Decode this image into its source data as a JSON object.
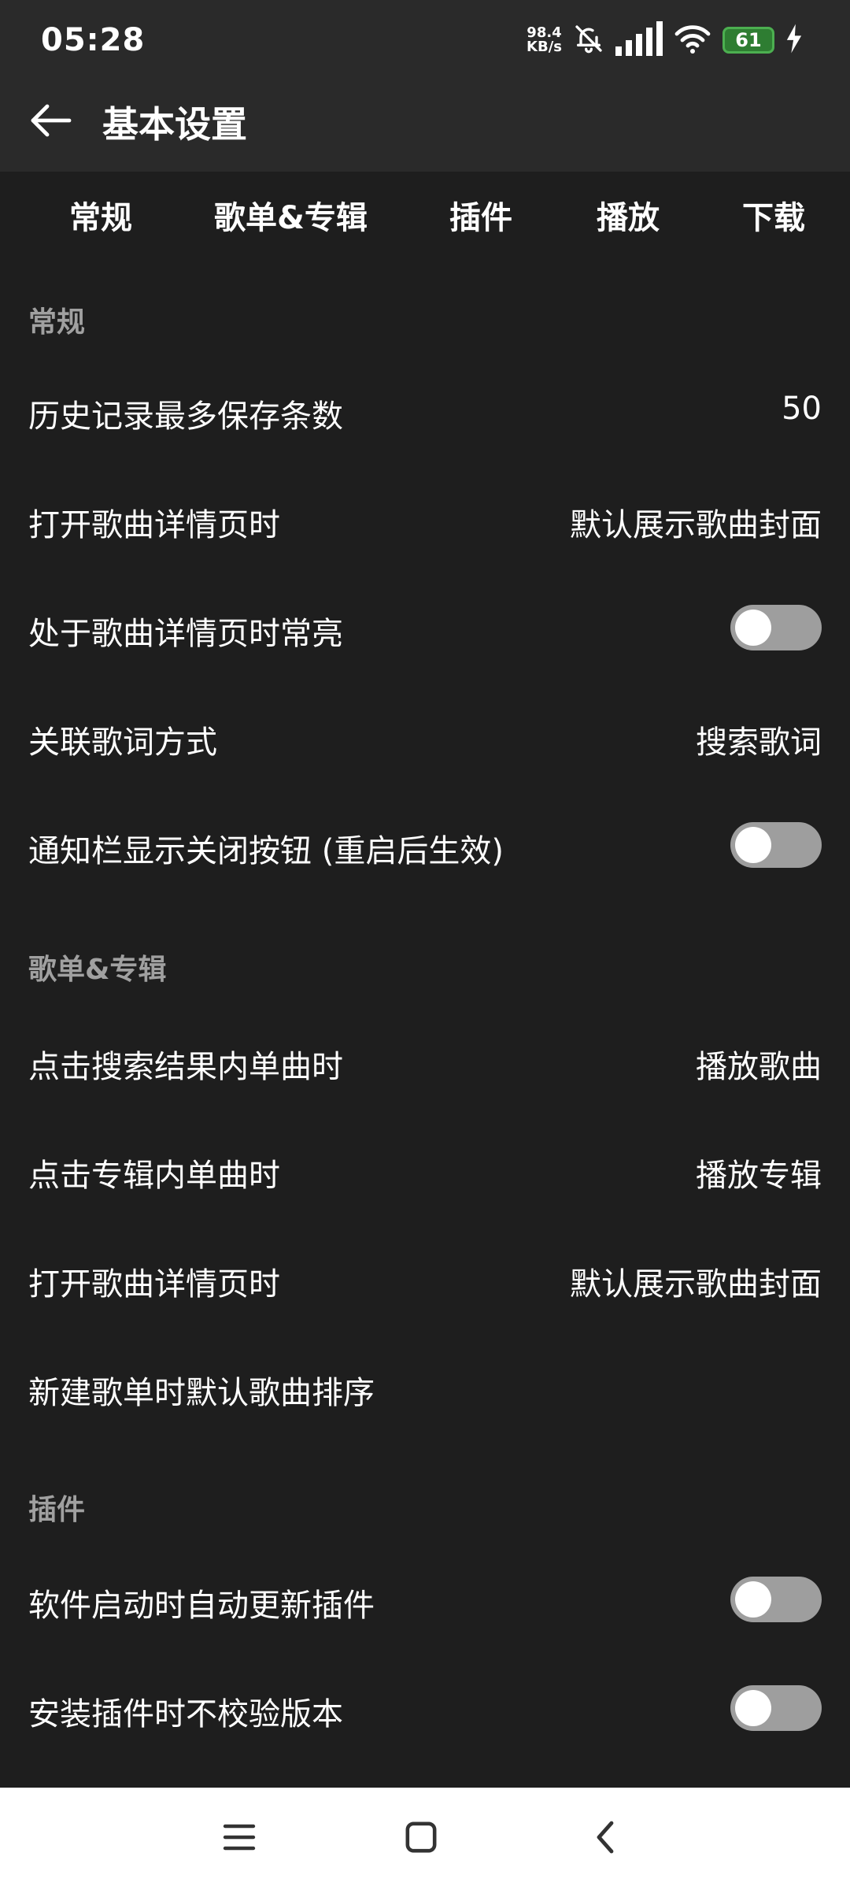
{
  "status": {
    "time": "05:28",
    "net_speed_value": "98.4",
    "net_speed_unit": "KB/s",
    "battery": "61"
  },
  "header": {
    "title": "基本设置"
  },
  "tabs": [
    "常规",
    "歌单&专辑",
    "插件",
    "播放",
    "下载"
  ],
  "sections": {
    "general": {
      "title": "常规",
      "rows": [
        {
          "label": "历史记录最多保存条数",
          "value": "50"
        },
        {
          "label": "打开歌曲详情页时",
          "value": "默认展示歌曲封面"
        },
        {
          "label": "处于歌曲详情页时常亮",
          "toggle": false
        },
        {
          "label": "关联歌词方式",
          "value": "搜索歌词"
        },
        {
          "label": "通知栏显示关闭按钮 (重启后生效)",
          "toggle": false
        }
      ]
    },
    "playlist": {
      "title": "歌单&专辑",
      "rows": [
        {
          "label": "点击搜索结果内单曲时",
          "value": "播放歌曲"
        },
        {
          "label": "点击专辑内单曲时",
          "value": "播放专辑"
        },
        {
          "label": "打开歌曲详情页时",
          "value": "默认展示歌曲封面"
        },
        {
          "label": "新建歌单时默认歌曲排序",
          "value": ""
        }
      ]
    },
    "plugins": {
      "title": "插件",
      "rows": [
        {
          "label": "软件启动时自动更新插件",
          "toggle": false
        },
        {
          "label": "安装插件时不校验版本",
          "toggle": false
        }
      ]
    }
  },
  "icons": {
    "back": "arrow-left-icon",
    "mute": "bell-off-icon",
    "signal": "signal-icon",
    "wifi": "wifi-icon",
    "charging": "bolt-icon",
    "nav_menu": "menu-icon",
    "nav_home": "square-icon",
    "nav_back": "chevron-left-icon"
  },
  "colors": {
    "background": "#1e1e1e",
    "header": "#2a2a2a",
    "section_title": "#a0a0a0",
    "toggle_off": "#9e9e9e",
    "battery": "#4caf50"
  }
}
